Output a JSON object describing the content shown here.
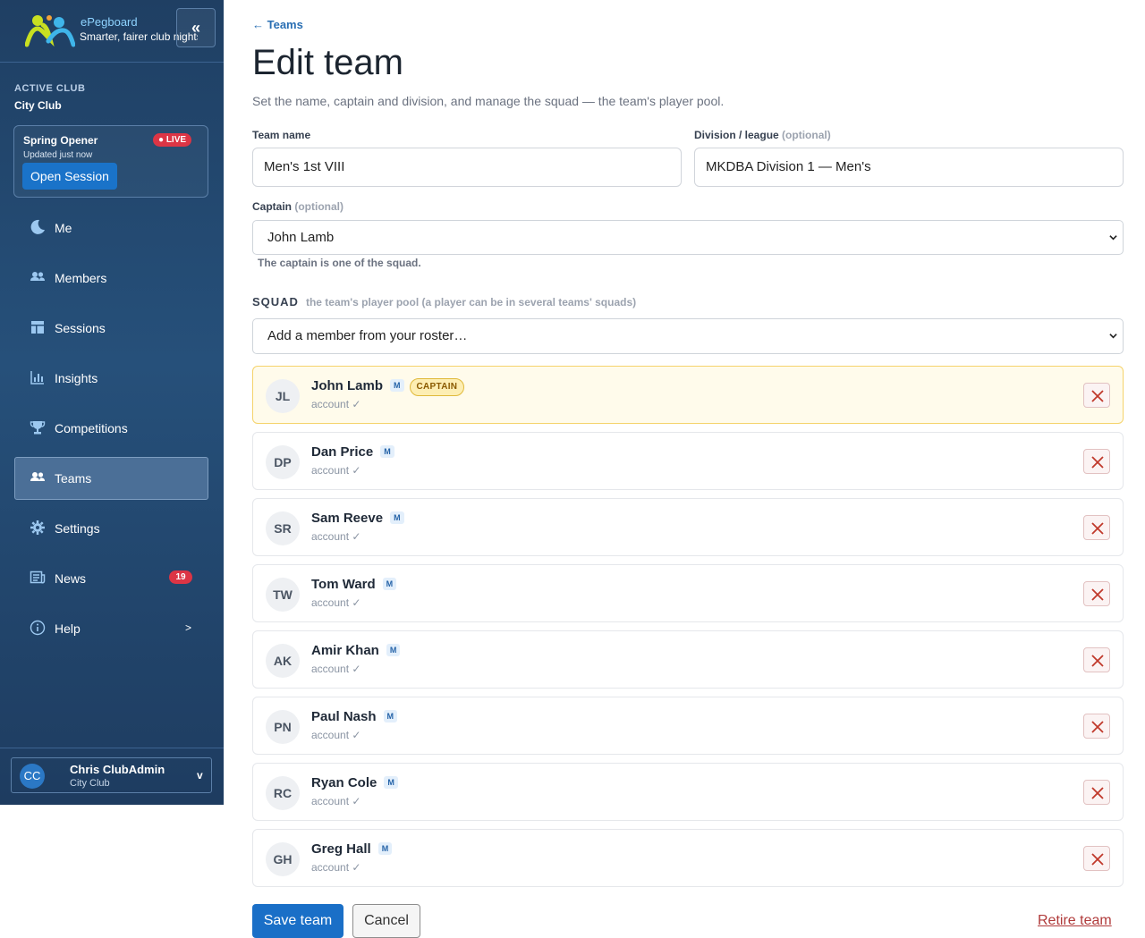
{
  "brand": {
    "name": "ePegboard",
    "tagline": "Smarter, fairer club nights",
    "collapse_label": "«"
  },
  "club": {
    "label": "ACTIVE CLUB",
    "name": "City Club"
  },
  "session": {
    "name": "Spring Opener",
    "live_label": "● LIVE",
    "updated": "Updated just now",
    "open_label": "Open Session"
  },
  "nav": [
    {
      "label": "Me",
      "icon": "moon-icon"
    },
    {
      "label": "Members",
      "icon": "members-icon"
    },
    {
      "label": "Sessions",
      "icon": "sessions-icon"
    },
    {
      "label": "Insights",
      "icon": "chart-icon"
    },
    {
      "label": "Competitions",
      "icon": "trophy-icon"
    },
    {
      "label": "Teams",
      "icon": "teams-icon",
      "active": true
    },
    {
      "label": "Settings",
      "icon": "gear-icon"
    },
    {
      "label": "News",
      "icon": "news-icon",
      "badge": "19"
    },
    {
      "label": "Help",
      "icon": "info-icon",
      "chevron": ">"
    }
  ],
  "user": {
    "initials": "CC",
    "name": "Chris ClubAdmin",
    "club": "City Club",
    "chevron": "v"
  },
  "page": {
    "back": "← Teams",
    "title": "Edit team",
    "subtitle": "Set the name, captain and division, and manage the squad — the team's player pool."
  },
  "form": {
    "team_name_label": "Team name",
    "team_name_value": "Men's 1st VIII",
    "division_label": "Division / league",
    "division_optional": "(optional)",
    "division_value": "MKDBA Division 1 — Men's",
    "captain_label": "Captain",
    "captain_optional": "(optional)",
    "captain_value": "John Lamb",
    "captain_hint": "The captain is one of the squad."
  },
  "squad": {
    "heading": "SQUAD",
    "description": "the team's player pool (a player can be in several teams' squads)",
    "add_placeholder": "Add a member from your roster…",
    "members": [
      {
        "initials": "JL",
        "name": "John Lamb",
        "tag": "M",
        "status": "account ✓",
        "captain": "CAPTAIN"
      },
      {
        "initials": "DP",
        "name": "Dan Price",
        "tag": "M",
        "status": "account ✓"
      },
      {
        "initials": "SR",
        "name": "Sam Reeve",
        "tag": "M",
        "status": "account ✓"
      },
      {
        "initials": "TW",
        "name": "Tom Ward",
        "tag": "M",
        "status": "account ✓"
      },
      {
        "initials": "AK",
        "name": "Amir Khan",
        "tag": "M",
        "status": "account ✓"
      },
      {
        "initials": "PN",
        "name": "Paul Nash",
        "tag": "M",
        "status": "account ✓"
      },
      {
        "initials": "RC",
        "name": "Ryan Cole",
        "tag": "M",
        "status": "account ✓"
      },
      {
        "initials": "GH",
        "name": "Greg Hall",
        "tag": "M",
        "status": "account ✓"
      }
    ]
  },
  "actions": {
    "save": "Save team",
    "cancel": "Cancel",
    "retire": "Retire team"
  },
  "colors": {
    "sidebar": "#1f3f63",
    "primary": "#1a6fc7",
    "danger": "#dc3545",
    "captain_bg": "#fffbeb"
  }
}
